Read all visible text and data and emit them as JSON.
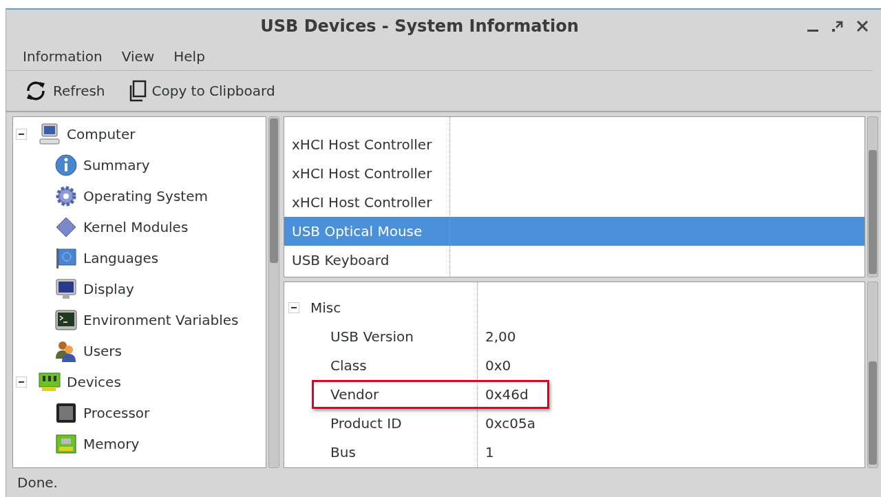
{
  "window": {
    "title": "USB Devices - System Information"
  },
  "menu": [
    "Information",
    "View",
    "Help"
  ],
  "toolbar": [
    {
      "label": "Refresh"
    },
    {
      "label": "Copy to Clipboard"
    }
  ],
  "sidebar": {
    "items": [
      {
        "label": "Computer",
        "expanded": true,
        "children": [
          {
            "label": "Summary"
          },
          {
            "label": "Operating System"
          },
          {
            "label": "Kernel Modules"
          },
          {
            "label": "Languages"
          },
          {
            "label": "Display"
          },
          {
            "label": "Environment Variables"
          },
          {
            "label": "Users"
          }
        ]
      },
      {
        "label": "Devices",
        "expanded": true,
        "children": [
          {
            "label": "Processor"
          },
          {
            "label": "Memory"
          }
        ]
      }
    ]
  },
  "device_list": [
    {
      "label": "xHCI Host Controller",
      "selected": false
    },
    {
      "label": "xHCI Host Controller",
      "selected": false
    },
    {
      "label": "xHCI Host Controller",
      "selected": false
    },
    {
      "label": "USB Optical Mouse",
      "selected": true
    },
    {
      "label": "USB Keyboard",
      "selected": false
    }
  ],
  "details": {
    "section": "Misc",
    "expanded": true,
    "rows": [
      {
        "label": "USB Version",
        "value": "2,00",
        "highlighted": false
      },
      {
        "label": "Class",
        "value": "0x0",
        "highlighted": false
      },
      {
        "label": "Vendor",
        "value": "0x46d",
        "highlighted": true
      },
      {
        "label": "Product ID",
        "value": "0xc05a",
        "highlighted": false
      },
      {
        "label": "Bus",
        "value": "1",
        "highlighted": false
      }
    ]
  },
  "status_bar": "Done."
}
